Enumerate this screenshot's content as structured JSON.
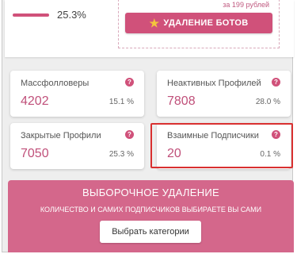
{
  "top": {
    "progress_percent": "25.3%",
    "price_note": "за 199 рублей",
    "bot_removal_label": "УДАЛЕНИЕ БОТОВ"
  },
  "stats": [
    {
      "label": "Массфолловеры",
      "value": "4202",
      "percent": "15.1 %"
    },
    {
      "label": "Неактивных Профилей",
      "value": "7808",
      "percent": "28.0 %"
    },
    {
      "label": "Закрытые Профили",
      "value": "7050",
      "percent": "25.3 %"
    },
    {
      "label": "Взаимные Подписчики",
      "value": "20",
      "percent": "0.1 %"
    }
  ],
  "help_glyph": "?",
  "selective": {
    "title": "ВЫБОРОЧНОЕ УДАЛЕНИЕ",
    "subtitle": "КОЛИЧЕСТВО И САМИХ ПОДПИСЧИКОВ ВЫБИРАЕТЕ ВЫ САМИ",
    "button_label": "Выбрать категории"
  },
  "colors": {
    "accent": "#d0517a",
    "highlight": "#d93030"
  }
}
